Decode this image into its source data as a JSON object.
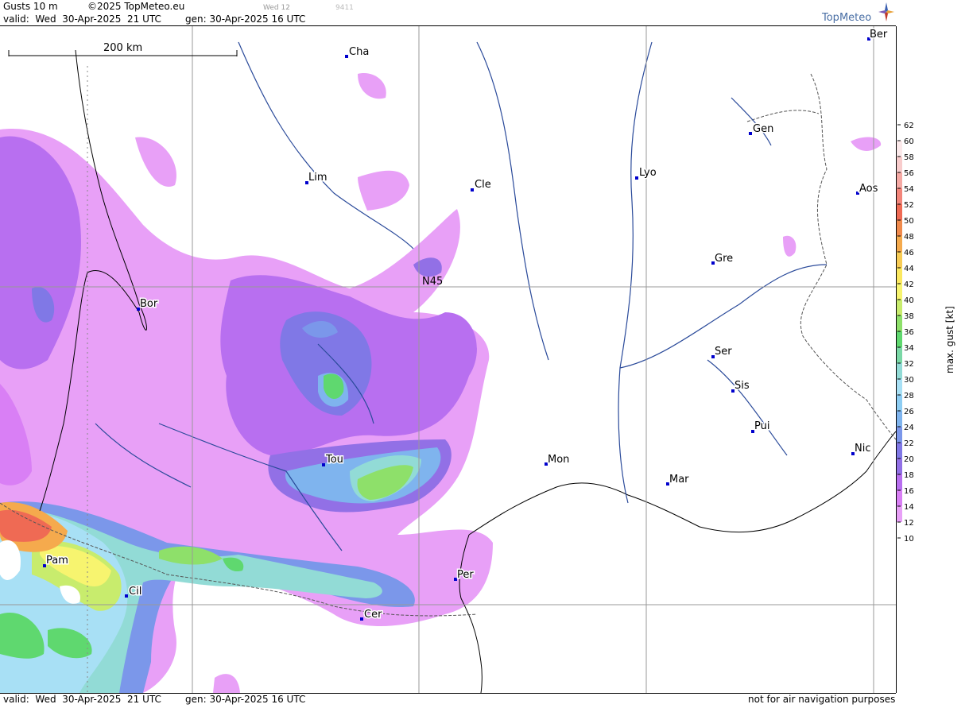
{
  "header": {
    "param": "Gusts 10 m",
    "copyright": "©2025 TopMeteo.eu",
    "day_small": "Wed 12",
    "code_small": "9411",
    "valid": "valid:  Wed  30-Apr-2025  21 UTC",
    "gen": "gen: 30-Apr-2025 16 UTC",
    "brand": "TopMeteo"
  },
  "map": {
    "scale_label": "200 km",
    "lat_label": "N45",
    "cities": [
      {
        "name": "Cha"
      },
      {
        "name": "Ber"
      },
      {
        "name": "Gen"
      },
      {
        "name": "Lim"
      },
      {
        "name": "Cle"
      },
      {
        "name": "Lyo"
      },
      {
        "name": "Aos"
      },
      {
        "name": "Gre"
      },
      {
        "name": "Bor"
      },
      {
        "name": "Ser"
      },
      {
        "name": "Sis"
      },
      {
        "name": "Pui"
      },
      {
        "name": "Tou"
      },
      {
        "name": "Mon"
      },
      {
        "name": "Nic"
      },
      {
        "name": "Mar"
      },
      {
        "name": "Pam"
      },
      {
        "name": "Cil"
      },
      {
        "name": "Per"
      },
      {
        "name": "Cer"
      }
    ]
  },
  "footer": {
    "valid": "valid:  Wed  30-Apr-2025  21 UTC",
    "gen": "gen: 30-Apr-2025 16 UTC",
    "note": "not for air navigation purposes"
  },
  "legend": {
    "title": "max. gust  [kt]",
    "ticks": [
      "62",
      "60",
      "58",
      "56",
      "54",
      "52",
      "50",
      "48",
      "46",
      "44",
      "42",
      "40",
      "38",
      "36",
      "34",
      "32",
      "30",
      "28",
      "26",
      "24",
      "22",
      "20",
      "18",
      "16",
      "14",
      "12",
      "10"
    ],
    "colors": [
      "#fbe9ea",
      "#f8cccc",
      "#f5a9a4",
      "#f3857a",
      "#ef6a54",
      "#f08a4c",
      "#f5aa4d",
      "#f8cc55",
      "#fbe85f",
      "#f7f46f",
      "#c8ec6d",
      "#8ee06a",
      "#5fd86f",
      "#7ad8a6",
      "#92dbd6",
      "#a8e0f5",
      "#8dcdf3",
      "#7fb4ee",
      "#7b97ea",
      "#8078e6",
      "#9270e6",
      "#b86ff0",
      "#d97ff5",
      "#e8a0f7"
    ],
    "accent": "#d97ff5"
  }
}
